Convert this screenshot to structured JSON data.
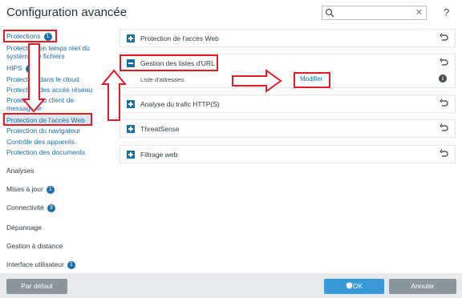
{
  "window": {
    "title": "Configuration avancée",
    "help_glyph": "?"
  },
  "search": {
    "value": "",
    "placeholder": "",
    "clear_glyph": "✕"
  },
  "sidebar": {
    "items": [
      {
        "label": "Protections",
        "badge": "1"
      },
      {
        "label": "Protection en temps réel du système de fichiers"
      },
      {
        "label": "HIPS",
        "badge": "1"
      },
      {
        "label": "Protection dans le cloud"
      },
      {
        "label": "Protection des accès réseau"
      },
      {
        "label": "Protection du client de messagerie"
      },
      {
        "label": "Protection de l'accès Web"
      },
      {
        "label": "Protection du navigateur"
      },
      {
        "label": "Contrôle des appareils"
      },
      {
        "label": "Protection des documents"
      },
      {
        "label": "Analyses"
      },
      {
        "label": "Mises à jour",
        "badge": "1"
      },
      {
        "label": "Connectivité",
        "badge": "3"
      },
      {
        "label": "Dépannage"
      },
      {
        "label": "Gestion à distance"
      },
      {
        "label": "Interface utilisateur",
        "badge": "1"
      }
    ]
  },
  "main": {
    "sections": [
      {
        "label": "Protection de l'accès Web",
        "expanded": false
      },
      {
        "label": "Gestion des listes d'URL",
        "expanded": true,
        "setting": {
          "label": "Liste d'adresses",
          "action": "Modifier"
        }
      },
      {
        "label": "Analyse du trafic HTTP(S)",
        "expanded": false
      },
      {
        "label": "ThreatSense",
        "expanded": false
      },
      {
        "label": "Filtrage web",
        "expanded": false
      }
    ]
  },
  "footer": {
    "default_label": "Par défaut",
    "ok_label": "OK",
    "cancel_label": "Annuler"
  },
  "colors": {
    "accent": "#1a6fa8",
    "annotation": "#e01c24",
    "ok": "#3a99d8"
  },
  "icons": [
    "search-icon",
    "clear-icon",
    "help-icon",
    "plus-icon",
    "minus-icon",
    "undo-icon",
    "info-icon",
    "shield-icon"
  ]
}
